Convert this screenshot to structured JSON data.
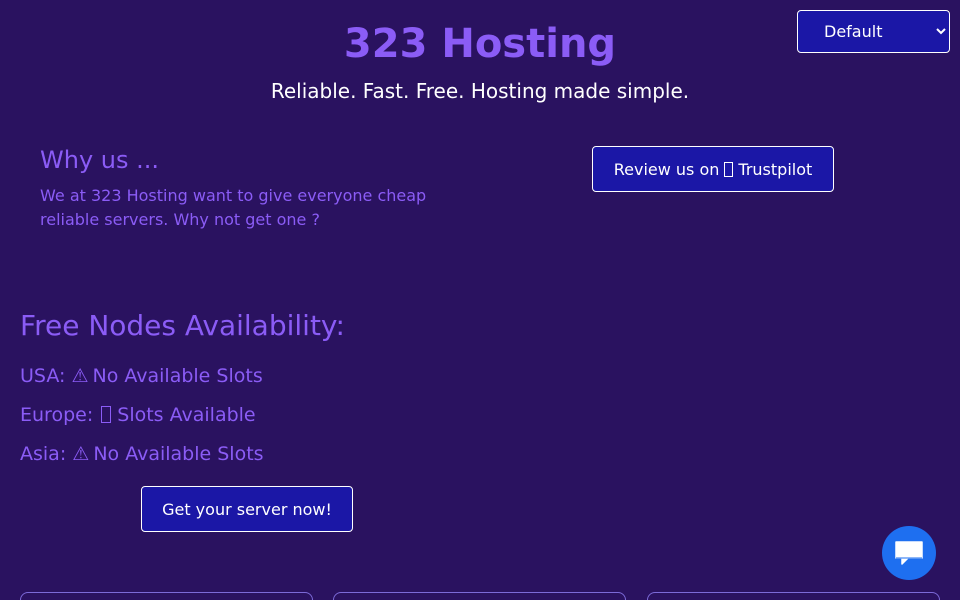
{
  "theme_select": {
    "selected": "Default"
  },
  "header": {
    "title": "323 Hosting",
    "tagline": "Reliable. Fast. Free. Hosting made simple."
  },
  "why": {
    "heading": "Why us ...",
    "text": "We at 323 Hosting want to give everyone cheap reliable servers. Why not get one ?"
  },
  "review": {
    "label_prefix": "Review us on",
    "label_brand": "Trustpilot"
  },
  "nodes": {
    "heading": "Free Nodes Availability:",
    "items": [
      {
        "region": "USA:",
        "status_icon": "warning-icon",
        "status": "No Available Slots"
      },
      {
        "region": "Europe:",
        "status_icon": "missing-glyph-icon",
        "status": "Slots Available"
      },
      {
        "region": "Asia:",
        "status_icon": "warning-icon",
        "status": "No Available Slots"
      }
    ]
  },
  "cta": {
    "label": "Get your server now!"
  },
  "chat": {
    "icon": "chat-bubble-icon",
    "color": "#1e6ff0"
  },
  "colors": {
    "background": "#2a1260",
    "accent": "#8b5cf6",
    "button": "#1b17a6"
  }
}
